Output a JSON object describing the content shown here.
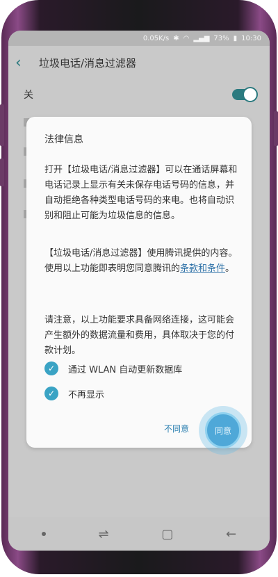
{
  "status_bar": {
    "speed": "0.05K/s",
    "battery": "73%",
    "time": "10:30"
  },
  "header": {
    "title": "垃圾电话/消息过滤器"
  },
  "master_switch": {
    "label": "关"
  },
  "dialog": {
    "title": "法律信息",
    "para1": "打开【垃圾电话/消息过滤器】可以在通话屏幕和电话记录上显示有关未保存电话号码的信息，并自动拒绝各种类型电话号码的来电。也将自动识别和阻止可能为垃圾信息的信息。",
    "para2_prefix": "【垃圾电话/消息过滤器】使用腾讯提供的内容。使用以上功能即表明您同意腾讯的",
    "para2_link": "条款和条件",
    "para2_suffix": "。",
    "para3": "请注意，以上功能要求具备网络连接，这可能会产生额外的数据流量和费用，具体取决于您的付款计划。",
    "checkbox1": "通过 WLAN 自动更新数据库",
    "checkbox2": "不再显示",
    "disagree": "不同意",
    "agree": "同意"
  },
  "colors": {
    "accent": "#2b7a7f",
    "link": "#2a6fa6",
    "check": "#3aa3c4"
  }
}
